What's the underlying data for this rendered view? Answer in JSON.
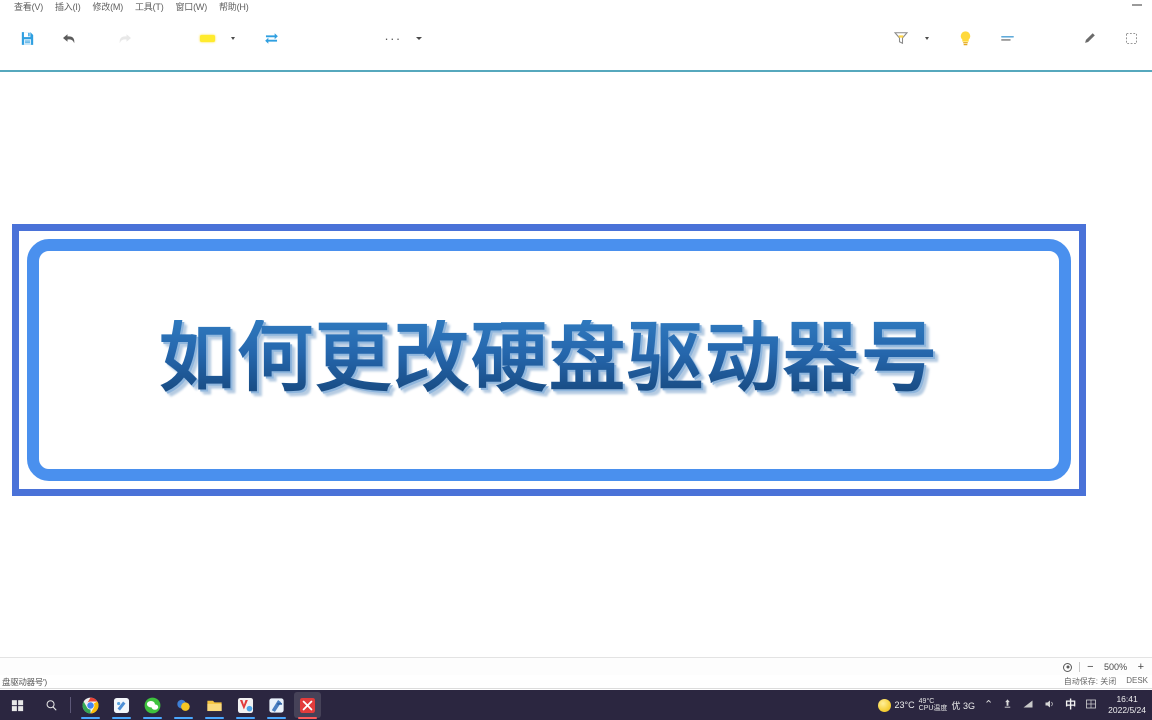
{
  "window": {
    "minimize_label": "—"
  },
  "menubar": {
    "items": [
      {
        "label": "查看(V)",
        "name": "menu-view"
      },
      {
        "label": "插入(I)",
        "name": "menu-insert"
      },
      {
        "label": "修改(M)",
        "name": "menu-modify"
      },
      {
        "label": "工具(T)",
        "name": "menu-tools"
      },
      {
        "label": "窗口(W)",
        "name": "menu-window"
      },
      {
        "label": "帮助(H)",
        "name": "menu-help"
      }
    ]
  },
  "toolbar": {
    "save_tooltip": "保存",
    "undo_tooltip": "撤销",
    "redo_tooltip": "恢复",
    "highlight_tooltip": "荧光笔",
    "swap_tooltip": "替换",
    "more_tooltip": "更多",
    "filter_tooltip": "筛选",
    "idea_tooltip": "智能助手",
    "list_tooltip": "列表",
    "pen_tooltip": "画笔",
    "select_tooltip": "选择",
    "overflow_label": "···",
    "highlight_color": "#ffeb2e"
  },
  "slide": {
    "title": "如何更改硬盘驱动器号",
    "outer_border_color": "#4a72d8",
    "inner_border_color": "#4a90ee",
    "title_color": "#2566ac"
  },
  "statusbar": {
    "fit_tooltip": "适应窗口",
    "zoom_out": "−",
    "zoom_level": "500%",
    "zoom_in": "+"
  },
  "document": {
    "name": "盘驱动器号')",
    "autosave_label": "自动保存:",
    "autosave_value": "关闭",
    "device": "DESK"
  },
  "taskbar": {
    "start_tooltip": "开始",
    "search_tooltip": "搜索",
    "apps": [
      {
        "name": "taskbar-app-chrome",
        "tooltip": "Google Chrome",
        "active": true
      },
      {
        "name": "taskbar-app-editor",
        "tooltip": "编辑器",
        "active": true
      },
      {
        "name": "taskbar-app-wechat",
        "tooltip": "微信",
        "active": true
      },
      {
        "name": "taskbar-app-media",
        "tooltip": "媒体",
        "active": true
      },
      {
        "name": "taskbar-app-explorer",
        "tooltip": "文件资源管理器",
        "active": true
      },
      {
        "name": "taskbar-app-video",
        "tooltip": "视频",
        "active": true
      },
      {
        "name": "taskbar-app-tools",
        "tooltip": "工具",
        "active": true
      },
      {
        "name": "taskbar-app-current",
        "tooltip": "当前应用",
        "active": true
      }
    ],
    "tray": {
      "temperature": "23°C",
      "cpu_temp": "49°C",
      "cpu_label": "CPU温度",
      "extra_text": "优 3G",
      "chevron": "⌃",
      "upload_icon": "⬆",
      "network_icon": "◤",
      "volume_icon": "◁»",
      "ime_label": "中",
      "keyboard_icon": "⊞",
      "time": "16:41",
      "date": "2022/5/24"
    }
  }
}
